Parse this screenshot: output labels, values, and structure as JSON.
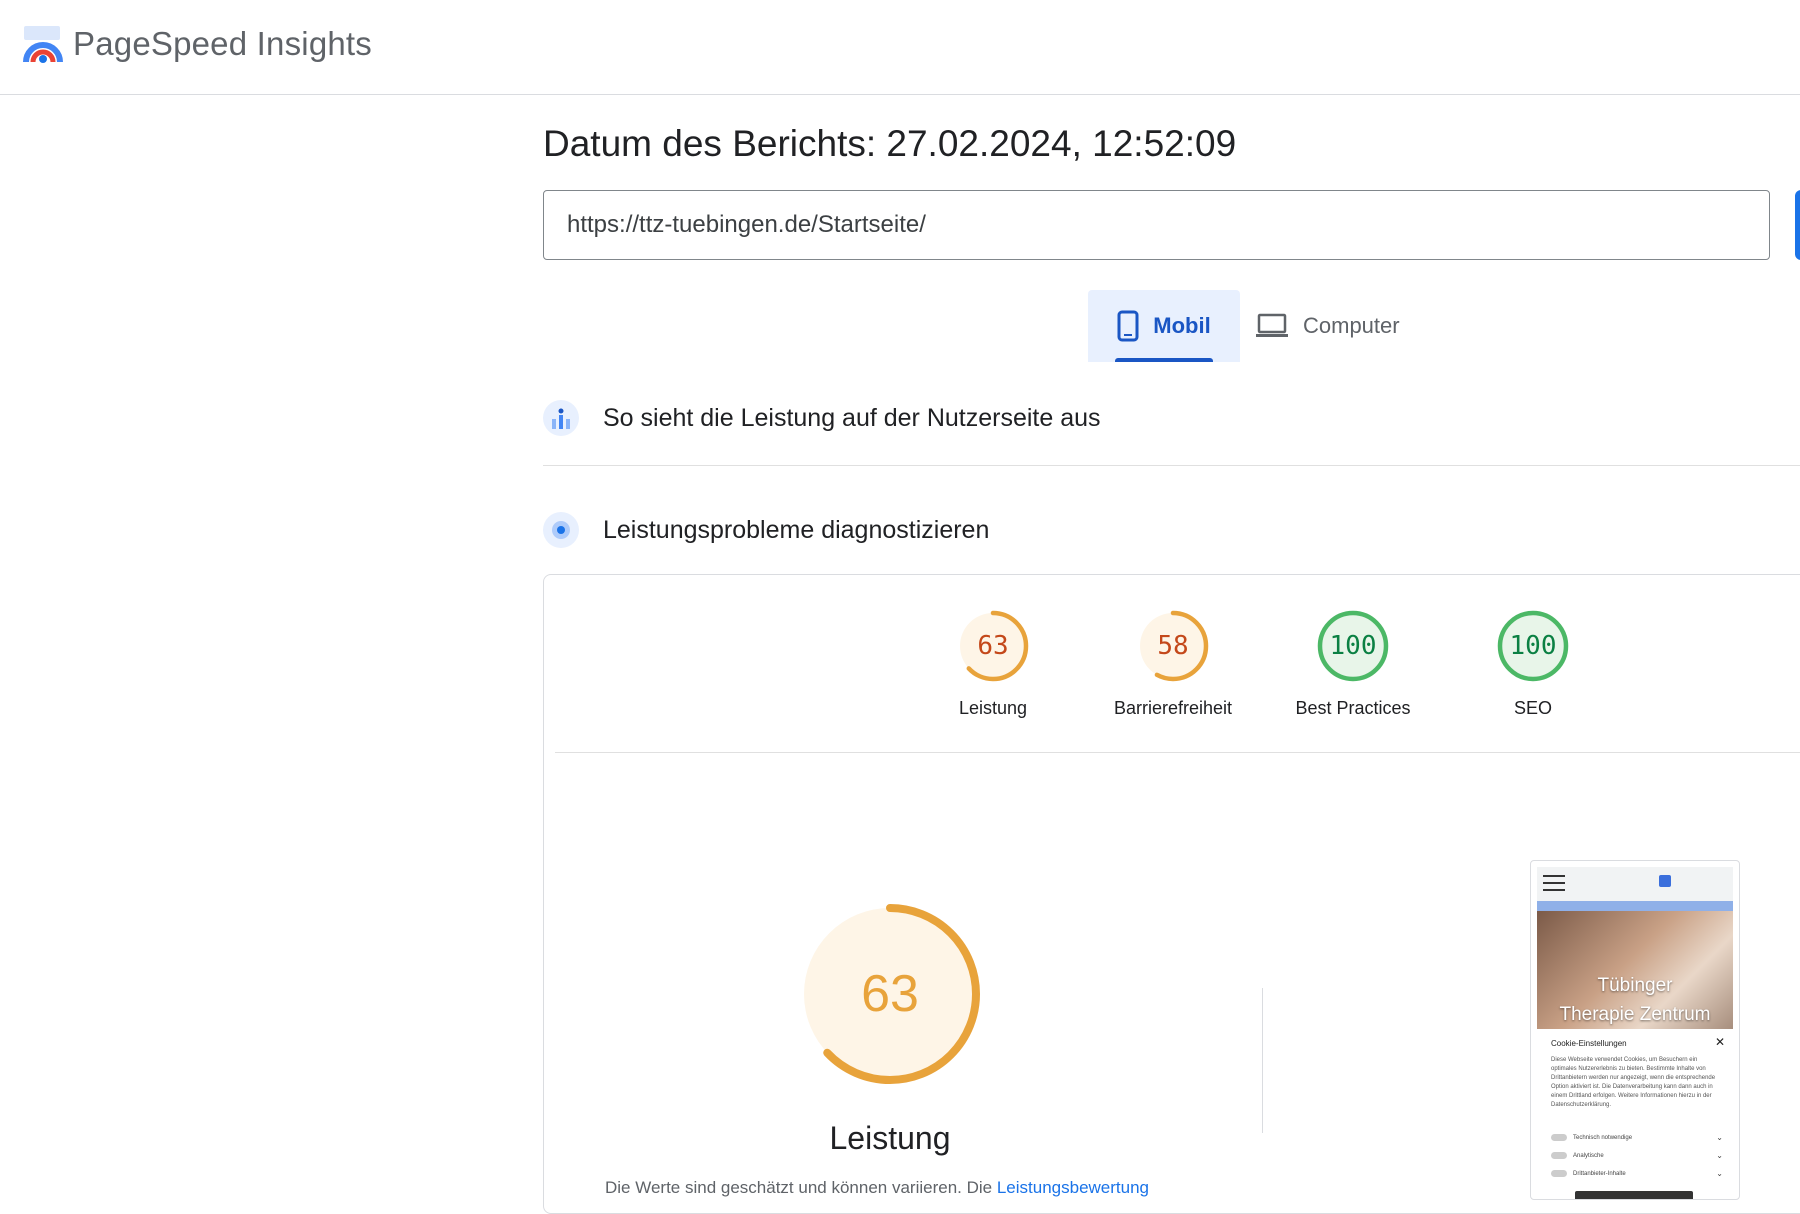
{
  "app": {
    "title": "PageSpeed Insights"
  },
  "report": {
    "date": "Datum des Berichts: 27.02.2024, 12:52:09"
  },
  "url_input": {
    "value": "https://ttz-tuebingen.de/Startseite/"
  },
  "device_tabs": [
    {
      "label": "Mobil",
      "icon": "smartphone-icon",
      "selected": true
    },
    {
      "label": "Computer",
      "icon": "laptop-icon",
      "selected": false
    }
  ],
  "sections": {
    "crux": {
      "label": "So sieht die Leistung auf der Nutzerseite aus",
      "icon": "people-chart-icon"
    },
    "diagnose": {
      "label": "Leistungsprobleme diagnostizieren",
      "icon": "lighthouse-icon"
    }
  },
  "scores": [
    {
      "label": "Leistung",
      "value": 63,
      "color": "#e8a33b",
      "text_color": "#c4481a",
      "fill": "#fef5e7"
    },
    {
      "label": "Barrierefreiheit",
      "value": 58,
      "color": "#e8a33b",
      "text_color": "#c4481a",
      "fill": "#fef5e7"
    },
    {
      "label": "Best Practices",
      "value": 100,
      "color": "#4cb866",
      "text_color": "#0b8043",
      "fill": "#e8f5e9"
    },
    {
      "label": "SEO",
      "value": 100,
      "color": "#4cb866",
      "text_color": "#0b8043",
      "fill": "#e8f5e9"
    }
  ],
  "performance": {
    "score": "63",
    "score_value": 63,
    "label": "Leistung",
    "note_text": "Die Werte sind geschätzt und können variieren. Die ",
    "note_link": "Leistungsbewertung"
  },
  "screenshot": {
    "hero_text": [
      "Tübinger",
      "Therapie Zentrum"
    ],
    "cookie_title": "Cookie-Einstellungen",
    "cookie_body": "Diese Webseite verwendet Cookies, um Besuchern ein optimales Nutzererlebnis zu bieten. Bestimmte Inhalte von Drittanbietern werden nur angezeigt, wenn die entsprechende Option aktiviert ist. Die Datenverarbeitung kann dann auch in einem Drittland erfolgen. Weitere Informationen hierzu in der Datenschutzerklärung.",
    "options": [
      "Technisch notwendige",
      "Analytische",
      "Drittanbieter-Inhalte"
    ]
  },
  "colors": {
    "accent": "#1a73e8",
    "average": "#e8a33b",
    "pass": "#4cb866"
  }
}
